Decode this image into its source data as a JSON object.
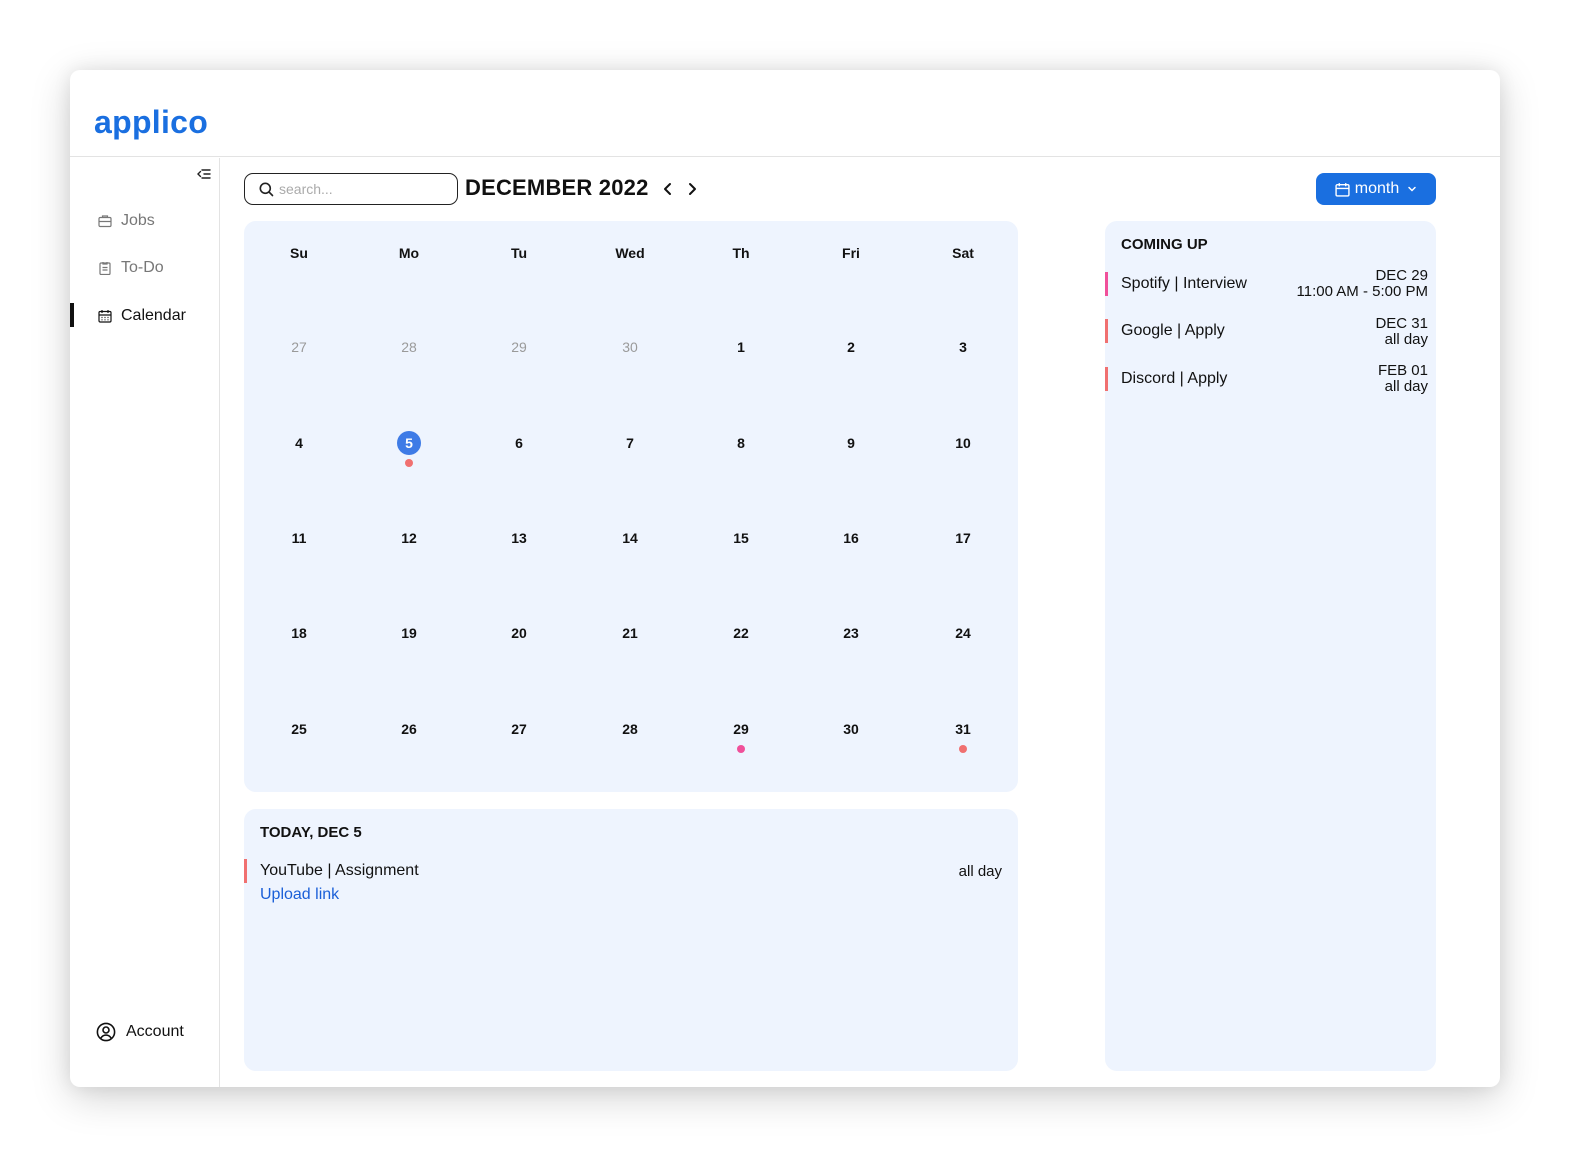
{
  "app": {
    "logo": "applico"
  },
  "sidebar": {
    "items": [
      {
        "label": "Jobs",
        "icon": "briefcase-icon"
      },
      {
        "label": "To-Do",
        "icon": "clipboard-icon"
      },
      {
        "label": "Calendar",
        "icon": "calendar-icon",
        "active": true
      }
    ],
    "account_label": "Account"
  },
  "toolbar": {
    "search_placeholder": "search...",
    "month_title": "DECEMBER 2022",
    "view_label": "month"
  },
  "calendar": {
    "weekdays": [
      "Su",
      "Mo",
      "Tu",
      "Wed",
      "Th",
      "Fri",
      "Sat"
    ],
    "weeks": [
      [
        "27",
        "28",
        "29",
        "30",
        "1",
        "2",
        "3"
      ],
      [
        "4",
        "5",
        "6",
        "7",
        "8",
        "9",
        "10"
      ],
      [
        "11",
        "12",
        "13",
        "14",
        "15",
        "16",
        "17"
      ],
      [
        "18",
        "19",
        "20",
        "21",
        "22",
        "23",
        "24"
      ],
      [
        "25",
        "26",
        "27",
        "28",
        "29",
        "30",
        "31"
      ]
    ],
    "selected_day": "5",
    "colors": {
      "today": "#3e7be6",
      "event_pink": "#f0509a",
      "event_red": "#f07070"
    }
  },
  "today": {
    "title": "TODAY, DEC 5",
    "events": [
      {
        "name": "YouTube | Assignment",
        "link": "Upload link",
        "time": "all day",
        "color": "#f07070"
      }
    ]
  },
  "upcoming": {
    "title": "COMING UP",
    "events": [
      {
        "name": "Spotify | Interview",
        "date": "DEC 29",
        "time": "11:00 AM - 5:00 PM",
        "color": "#f0509a"
      },
      {
        "name": "Google | Apply",
        "date": "DEC 31",
        "time": "all day",
        "color": "#f07070"
      },
      {
        "name": "Discord | Apply",
        "date": "FEB 01",
        "time": "all day",
        "color": "#f07070"
      }
    ]
  }
}
